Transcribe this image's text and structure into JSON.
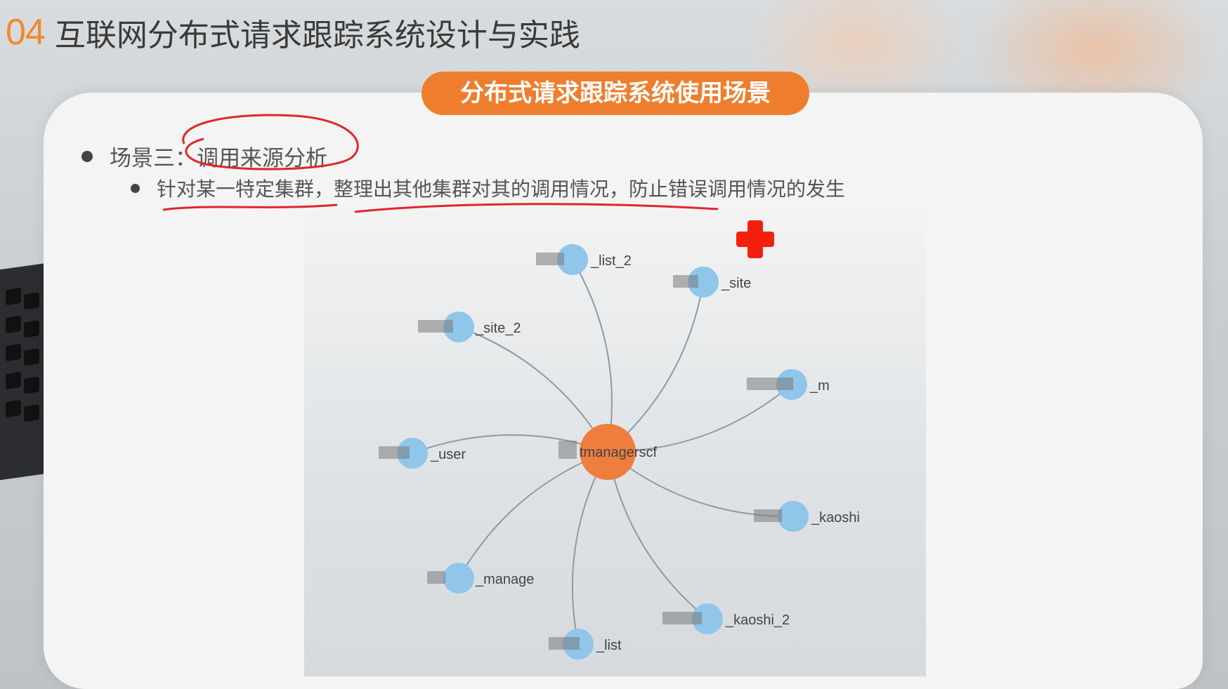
{
  "header": {
    "number": "04",
    "title": "互联网分布式请求跟踪系统设计与实践"
  },
  "section_pill": "分布式请求跟踪系统使用场景",
  "bullets": {
    "level1": "场景三：调用来源分析",
    "level2": "针对某一特定集群，整理出其他集群对其的调用情况，防止错误调用情况的发生"
  },
  "graph": {
    "center": {
      "label": "tmanagerscf",
      "color": "#ee7e3e"
    },
    "nodes": [
      {
        "label": "_list_2"
      },
      {
        "label": "_site"
      },
      {
        "label": "_site_2"
      },
      {
        "label": "_m"
      },
      {
        "label": "_user"
      },
      {
        "label": "_kaoshi"
      },
      {
        "label": "_manage"
      },
      {
        "label": "_kaoshi_2"
      },
      {
        "label": "_list"
      }
    ],
    "node_color": "#8fc6ea",
    "edge_color": "#8f9aa6"
  },
  "colors": {
    "accent": "#ee7e2e",
    "annotation": "#e0262a",
    "cross": "#f4200e"
  }
}
